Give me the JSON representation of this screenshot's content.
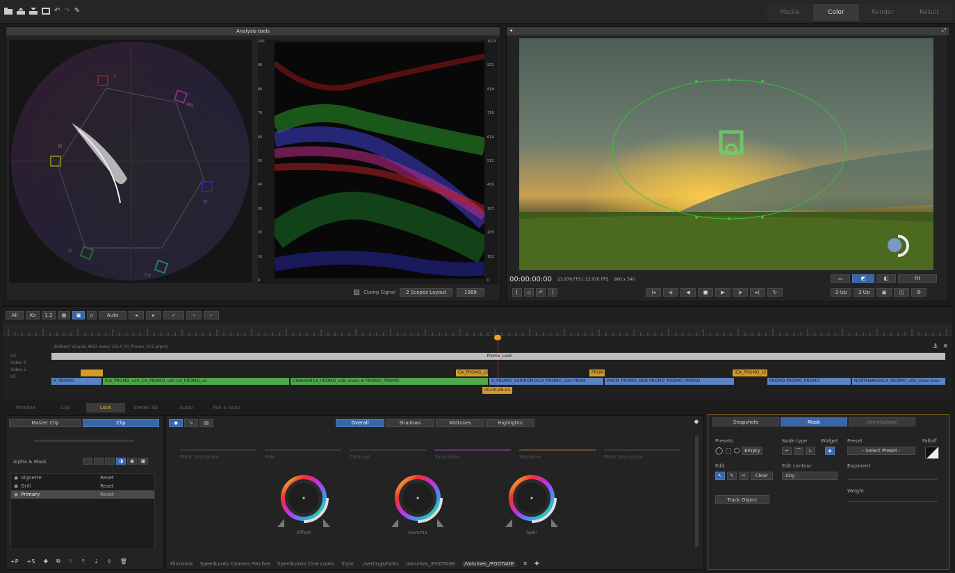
{
  "top_bar": {
    "mode_tabs": [
      {
        "label": "Media",
        "active": false
      },
      {
        "label": "Color",
        "active": true
      },
      {
        "label": "Render",
        "active": false
      },
      {
        "label": "Result",
        "active": false
      }
    ],
    "tool_icons": [
      "folder-icon",
      "import-icon",
      "export-icon",
      "film-icon",
      "undo-icon",
      "redo-icon",
      "wrench-icon"
    ]
  },
  "analysis": {
    "title": "Analysis tools",
    "vectorscope_labels": [
      "R",
      "Mg",
      "B",
      "Cy",
      "G",
      "Yl"
    ],
    "waveform_left_scale": [
      "100",
      "90",
      "80",
      "70",
      "60",
      "50",
      "40",
      "30",
      "20",
      "10",
      "0"
    ],
    "waveform_right_scale": [
      "1023",
      "921",
      "818",
      "716",
      "614",
      "512",
      "409",
      "307",
      "205",
      "102",
      "0"
    ],
    "clamp_signal_label": "Clamp Signal",
    "layout_select": "2 Scopes Layout",
    "bit_select": "10Bit"
  },
  "viewer": {
    "timecode": "00:00:00:00",
    "fps_info": "23.976 FPS | 23.976 FPS",
    "resolution": "960 x 540",
    "fit_select": "Fit",
    "split_buttons": [
      "2-Up",
      "3-Up"
    ]
  },
  "timeline": {
    "controls": [
      "All",
      "Ks",
      "1.2",
      "Auto"
    ],
    "sequence_name": "Brilliant Visuals_NKD.mwx/ 2014_OI_Promo_V12.prproj",
    "tracks": [
      "V3",
      "Video 3",
      "Video 2",
      "V1"
    ],
    "promo_clip": "Promo_Look",
    "playhead_timecode": "00:00:28:13",
    "clips_v2": [
      {
        "label": "CA_PROMO_v26",
        "color": "#d69a2a"
      },
      {
        "label": "PROM",
        "color": "#d69a2a"
      },
      {
        "label": "ICA_PROMO_v2",
        "color": "#d69a2a"
      }
    ],
    "clips_v1": [
      {
        "label": "A_PROMO",
        "color": "#5b82c4"
      },
      {
        "label": "ICA_PROMO_v20_CA_PROMO_v20 CA_PROMO_v2",
        "color": "#4da84a"
      },
      {
        "label": "CHAMGRICA_PROMO_v08_clean.m PROMO_PROMO",
        "color": "#4da84a"
      },
      {
        "label": "A_PROMO_V2(PROMO)CA_PROMO_V20 PROM",
        "color": "#5b82c4"
      },
      {
        "label": "PROM_PROMO_RDR PROMO_PROMO_PROMO",
        "color": "#5b82c4"
      },
      {
        "label": "PROMO PROMO_PROMO",
        "color": "#5b82c4"
      },
      {
        "label": "NORTHAMGRICA_PROMO_v08_clean.mov",
        "color": "#5b82c4"
      }
    ]
  },
  "bottom_tabs": [
    {
      "label": "Timeline",
      "active": false
    },
    {
      "label": "Clip",
      "active": false
    },
    {
      "label": "Look",
      "active": true
    },
    {
      "label": "Stereo 3D",
      "active": false
    },
    {
      "label": "Audio",
      "active": false
    },
    {
      "label": "Pan & Scan",
      "active": false
    }
  ],
  "left_panel": {
    "master_clip_label": "Master Clip",
    "clip_label": "Clip",
    "alpha_mask_label": "Alpha & Mask",
    "layers": [
      {
        "name": "Vignette",
        "reset": "Reset",
        "selected": false
      },
      {
        "name": "Grill",
        "reset": "Reset",
        "selected": false
      },
      {
        "name": "Primary",
        "reset": "Reset",
        "selected": true
      }
    ]
  },
  "center_panel": {
    "range_tabs": [
      {
        "label": "Overall",
        "active": true
      },
      {
        "label": "Shadows",
        "active": false
      },
      {
        "label": "Midtones",
        "active": false
      },
      {
        "label": "Highlights",
        "active": false
      }
    ],
    "slider_labels": [
      "Point Saturation",
      "Pole",
      "Contrast",
      "Saturation",
      "Negative",
      "Pivot Saturation"
    ],
    "wheel_labels": [
      "Offset",
      "Gamma",
      "Gain"
    ],
    "bins": [
      "Filmstock",
      "SpeedLooks Camera Patches",
      "SpeedLooks Cine Looks",
      "Style",
      "../settings/looks",
      "/Volumes_/FOOTAGE",
      "/Volumes_/FOOTAGE"
    ]
  },
  "right_panel": {
    "tabs": [
      {
        "label": "Snapshots",
        "active": false
      },
      {
        "label": "Mask",
        "active": true
      },
      {
        "label": "Annotations",
        "active": false
      }
    ],
    "presets_label": "Presets",
    "empty_button": "Empty",
    "node_type_label": "Node type",
    "widget_label": "Widget",
    "preset_label": "Preset",
    "preset_select": "- Select Preset -",
    "falloff_label": "Falloff",
    "edit_label": "Edit",
    "clear_button": "Clear",
    "edit_contour_label": "Edit contour",
    "contour_select": "Any",
    "exponent_label": "Exponent",
    "weight_label": "Weight",
    "track_object_button": "Track Object"
  }
}
